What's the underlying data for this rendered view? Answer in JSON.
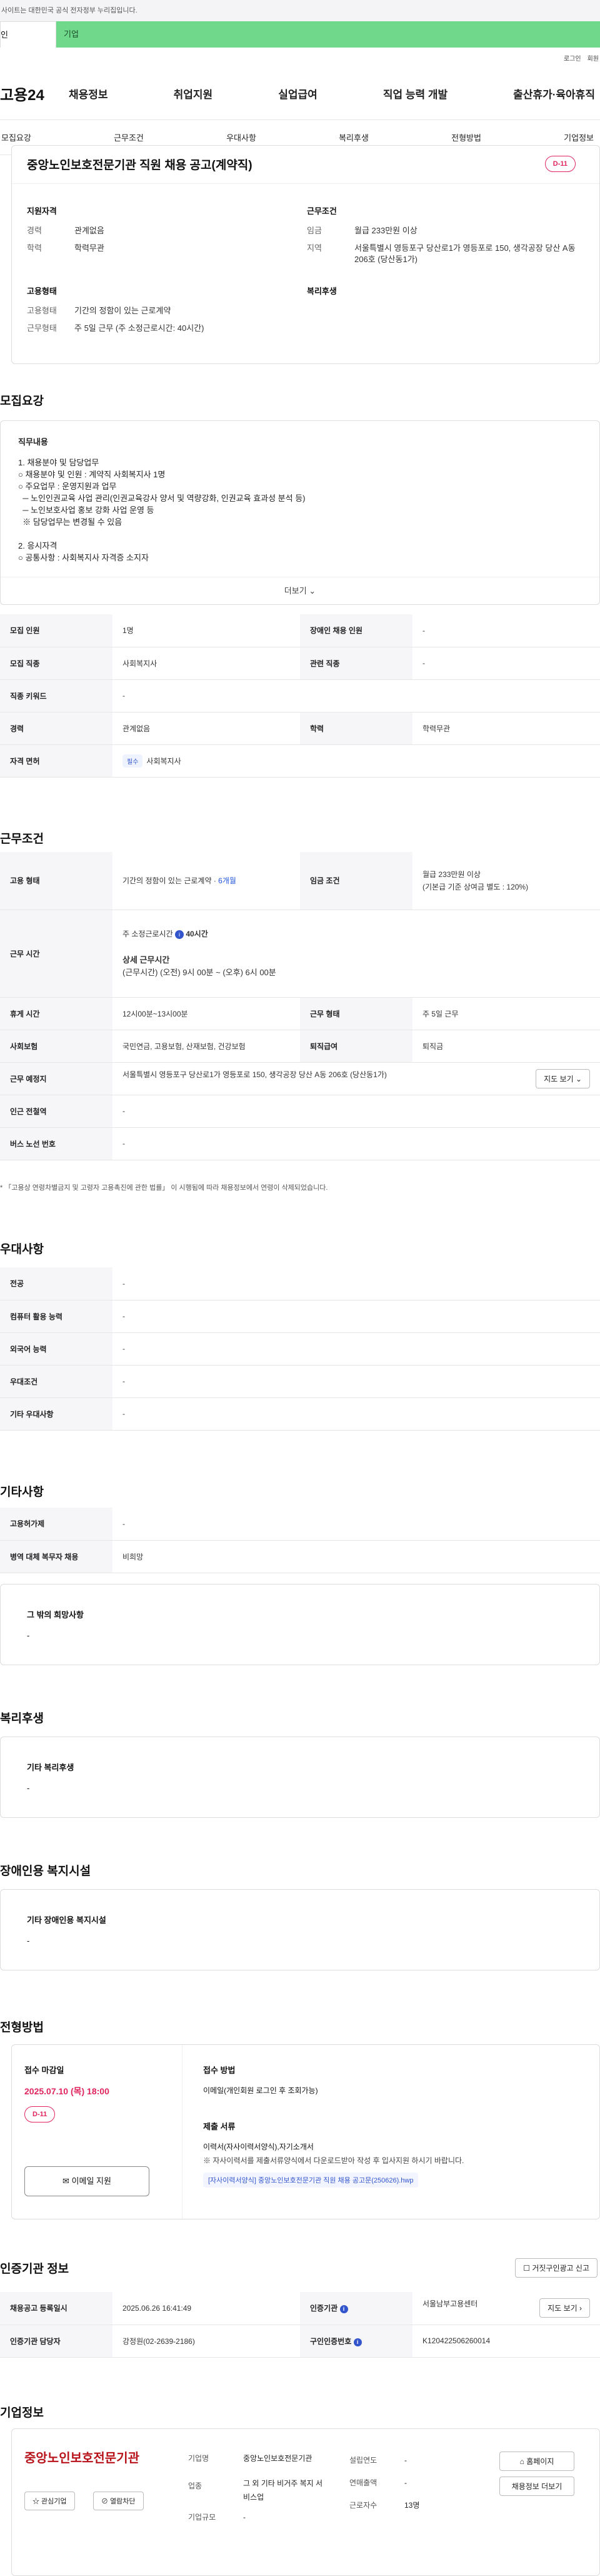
{
  "top": {
    "notice": "사이트는 대한민국 공식 전자정부 누리집입니다.",
    "tab_personal": "인",
    "tab_company": "기업",
    "login": "로그인",
    "join": "회원"
  },
  "gnb": {
    "logo": "고용24",
    "items": [
      "채용정보",
      "취업지원",
      "실업급여",
      "직업 능력 개발",
      "출산휴가·육아휴직"
    ]
  },
  "subnav": [
    "모집요강",
    "근무조건",
    "우대사항",
    "복리후생",
    "전형방법",
    "기업정보"
  ],
  "header": {
    "title": "중앙노인보호전문기관 직원 채용 공고(계약직)",
    "dday": "D-11",
    "qual_title": "지원자격",
    "career_k": "경력",
    "career_v": "관계없음",
    "edu_k": "학력",
    "edu_v": "학력무관",
    "cond_title": "근무조건",
    "wage_k": "임금",
    "wage_v": "월급 233만원 이상",
    "region_k": "지역",
    "region_v": "서울특별시 영등포구 당산로1가 영등포로 150, 생각공장 당산 A동 206호 (당산동1가)",
    "emp_title": "고용형태",
    "emptype_k": "고용형태",
    "emptype_v": "기간의 정함이 있는 근로계약",
    "worktype_k": "근무형태",
    "worktype_v": "주 5일 근무 (주 소정근로시간: 40시간)",
    "welfare_title": "복리후생"
  },
  "recruit": {
    "title": "모집요강",
    "duty_label": "직무내용",
    "duty_lines": [
      "1. 채용분야 및 담당업무",
      "○ 채용분야 및 인원 : 계약직 사회복지사 1명",
      "○ 주요업무 : 운영지원과 업무",
      "  ─ 노인인권교육 사업 관리(인권교육강사 양서 및 역량강화, 인권교육 효과성 분석 등)",
      "  ─ 노인보호사업 홍보 강화 사업 운영 등",
      "  ※ 담당업무는 변경될 수 있음",
      "",
      "2. 응시자격",
      "○ 공통사항 : 사회복지사 자격증 소지자"
    ],
    "more": "더보기 ⌄",
    "r1": {
      "k1": "모집 인원",
      "v1": "1명",
      "k2": "장애인 채용 인원",
      "v2": "-"
    },
    "r2": {
      "k1": "모집 직종",
      "v1": "사회복지사",
      "k2": "관련 직종",
      "v2": "-"
    },
    "r3": {
      "k1": "직종 키워드",
      "v1": "-"
    },
    "r4": {
      "k1": "경력",
      "v1": "관계없음",
      "k2": "학력",
      "v2": "학력무관"
    },
    "r5": {
      "k1": "자격 면허",
      "badge": "필수",
      "v1": "사회복지사"
    }
  },
  "work": {
    "title": "근무조건",
    "type_k": "고용 형태",
    "type_v": "기간의 정함이 있는 근로계약 · ",
    "type_v2": "6개월",
    "wage_k": "임금 조건",
    "wage_v": "월급 233만원 이상",
    "wage_v2": "(기본급 기준 상여금 별도 : 120%)",
    "time_k": "근무 시간",
    "time_v1": "주 소정근로시간",
    "time_v1b": "40시간",
    "time_v2": "상세 근무시간",
    "time_v3": "(근무시간) (오전) 9시 00분 ~ (오후) 6시 00분",
    "rest_k": "휴게 시간",
    "rest_v": "12시00분~13시00분",
    "form_k": "근무 형태",
    "form_v": "주 5일 근무",
    "ins_k": "사회보험",
    "ins_v": "국민연금, 고용보험, 산재보험, 건강보험",
    "ret_k": "퇴직급여",
    "ret_v": "퇴직금",
    "place_k": "근무 예정지",
    "place_v": "서울특별시 영등포구 당산로1가 영등포로 150, 생각공장 당산 A동 206호 (당산동1가)",
    "map_btn": "지도 보기 ⌄",
    "sub_k": "인근 전철역",
    "sub_v": "-",
    "bus_k": "버스 노선 번호",
    "bus_v": "-",
    "foot": "* 「고용상 연령차별금지 및 고령자 고용촉진에 관한 법률」 이 시행됨에 따라 채용정보에서 연령이 삭제되었습니다."
  },
  "pref": {
    "title": "우대사항",
    "rows": [
      {
        "k": "전공",
        "v": "-"
      },
      {
        "k": "컴퓨터 활용 능력",
        "v": "-"
      },
      {
        "k": "외국어 능력",
        "v": "-"
      },
      {
        "k": "우대조건",
        "v": "-"
      },
      {
        "k": "기타 우대사항",
        "v": "-"
      }
    ]
  },
  "etc": {
    "title": "기타사항",
    "rows": [
      {
        "k": "고용허가제",
        "v": "-"
      },
      {
        "k": "병역 대체 복무자 채용",
        "v": "비희망"
      }
    ],
    "other_k": "그 밖의 희망사항",
    "other_v": "-"
  },
  "welfare": {
    "title": "복리후생",
    "k": "기타 복리후생",
    "v": "-"
  },
  "disab": {
    "title": "장애인용 복지시설",
    "k": "기타 장애인용 복지시설",
    "v": "-"
  },
  "apply": {
    "title": "전형방법",
    "deadline_k": "접수 마감일",
    "deadline_v": "2025.07.10 (목) 18:00",
    "dday": "D-11",
    "email_btn": "✉ 이메일 지원",
    "method_k": "접수 방법",
    "method_v": "이메일(개인회원 로그인 후 조회가능)",
    "docs_k": "제출 서류",
    "docs_v1": "이력서(자사이력서양식),자기소개서",
    "docs_v2": "※ 자사이력서를 제출서류양식에서 다운로드받아 작성 후 입사지원 하시기 바랍니다.",
    "file": "[자사이력서양식] 중앙노인보호전문기관 직원 채용 공고문(250626).hwp"
  },
  "cert": {
    "title": "인증기관 정보",
    "cert_btn": "☐ 거짓구인광고 신고",
    "reg_k": "채용공고 등록일시",
    "reg_v": "2025.06.26 16:41:49",
    "inst_k": "인증기관",
    "inst_v": "서울남부고용센터",
    "map_btn": "지도 보기 ›",
    "mgr_k": "인증기관 담당자",
    "mgr_v": "강정원(02-2639-2186)",
    "no_k": "구인인증번호",
    "no_v": "K120422506260014"
  },
  "org": {
    "title": "기업정보",
    "logo_text": "중앙노인보호전문기관",
    "fav_btn": "☆ 관심기업",
    "block_btn": "⊘ 열람차단",
    "name_k": "기업명",
    "name_v": "중앙노인보호전문기관",
    "ind_k": "업종",
    "ind_v": "그 외 기타 비거주 복지 서비스업",
    "size_k": "기업규모",
    "size_v": "-",
    "est_k": "설립연도",
    "est_v": "-",
    "sales_k": "연매출액",
    "sales_v": "-",
    "emp_k": "근로자수",
    "emp_v": "13명",
    "home_btn": "⌂ 홈페이지",
    "other_btn": "채용정보 더보기"
  }
}
